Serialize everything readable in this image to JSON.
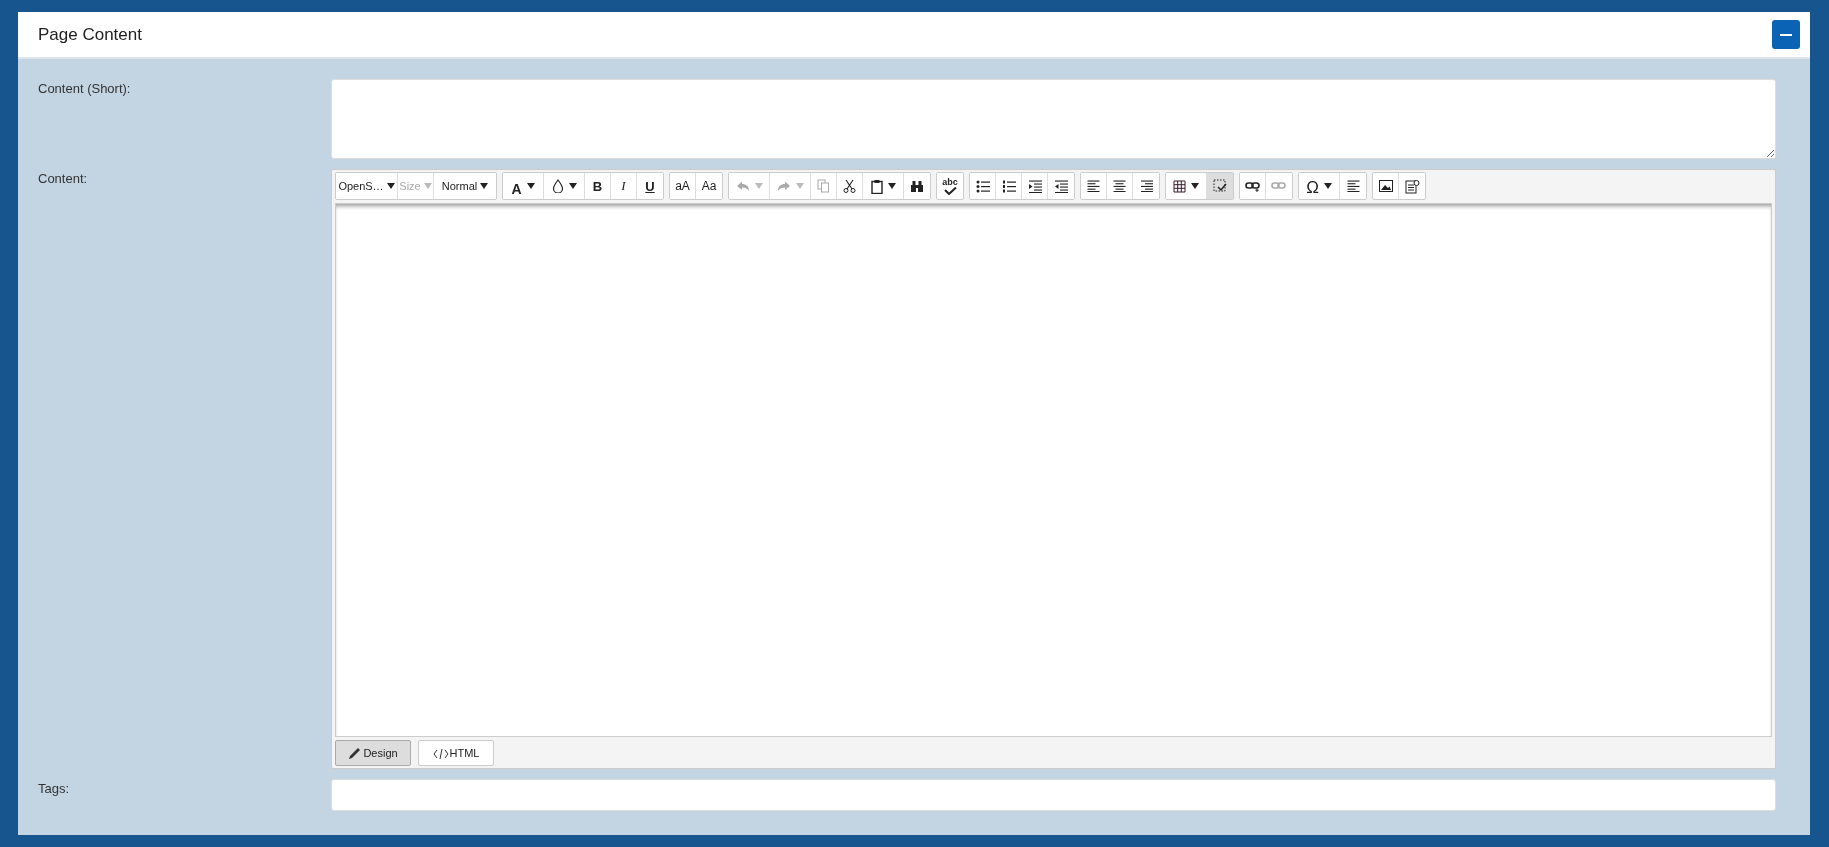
{
  "panel": {
    "title": "Page Content"
  },
  "fields": [
    {
      "label": "Content (Short):",
      "kind": "textarea"
    },
    {
      "label": "Content:",
      "kind": "editor"
    },
    {
      "label": "Tags:",
      "kind": "input"
    }
  ],
  "toolbar": [
    [
      {
        "kind": "dropdown",
        "label": "OpenS…",
        "disabled": false
      },
      {
        "kind": "dropdown",
        "label": "Size",
        "disabled": true
      },
      {
        "kind": "dropdown",
        "label": "Normal",
        "disabled": false
      }
    ],
    [
      {
        "kind": "icon",
        "label": "A",
        "disabled": false
      },
      {
        "kind": "icon",
        "disabled": false
      },
      {
        "kind": "text",
        "label": "B"
      },
      {
        "kind": "text",
        "label": "I"
      },
      {
        "kind": "text",
        "label": "U"
      }
    ],
    [
      {
        "kind": "text",
        "label": "aA"
      },
      {
        "kind": "text",
        "label": "Aa"
      }
    ],
    [
      {
        "kind": "icon",
        "disabled": true
      },
      {
        "kind": "icon",
        "disabled": true
      },
      {
        "kind": "icon",
        "disabled": true
      },
      {
        "kind": "icon",
        "disabled": false
      },
      {
        "kind": "icon",
        "disabled": false
      },
      {
        "kind": "icon",
        "disabled": false
      }
    ],
    [
      {
        "kind": "icon",
        "label": "abc",
        "disabled": false
      }
    ],
    [
      {
        "kind": "icon",
        "disabled": false
      },
      {
        "kind": "icon",
        "disabled": false
      },
      {
        "kind": "icon",
        "disabled": false
      },
      {
        "kind": "icon",
        "disabled": false
      }
    ],
    [
      {
        "kind": "icon",
        "disabled": false
      },
      {
        "kind": "icon",
        "disabled": false
      },
      {
        "kind": "icon",
        "disabled": false
      }
    ],
    [
      {
        "kind": "icon",
        "disabled": false
      },
      {
        "kind": "toggle",
        "pressed": true
      }
    ],
    [
      {
        "kind": "icon",
        "disabled": false
      },
      {
        "kind": "icon",
        "disabled": true
      }
    ],
    [
      {
        "kind": "icon",
        "label": "Ω",
        "disabled": false
      },
      {
        "kind": "icon",
        "disabled": false
      }
    ],
    [
      {
        "kind": "icon",
        "disabled": false
      },
      {
        "kind": "icon",
        "disabled": false
      }
    ]
  ],
  "modes": [
    {
      "label": "Design",
      "selected": true
    },
    {
      "label": "HTML",
      "selected": false
    }
  ]
}
